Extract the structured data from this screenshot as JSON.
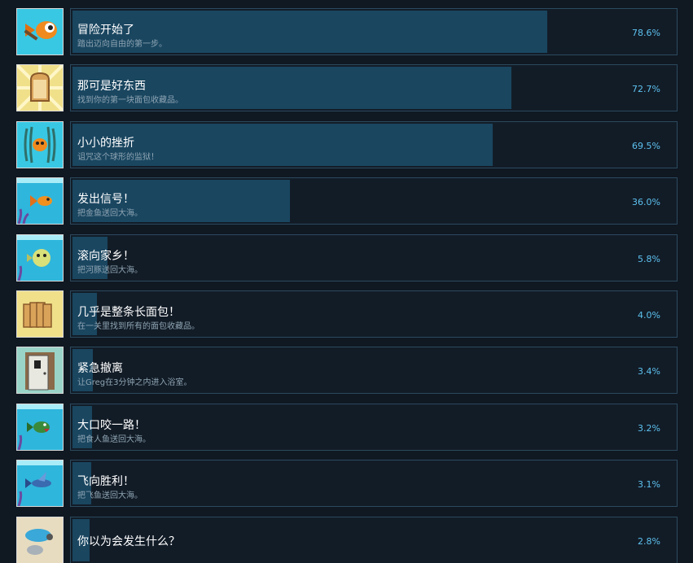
{
  "achievements": [
    {
      "title": "冒险开始了",
      "description": "踏出迈向自由的第一步。",
      "percent_label": "78.6%",
      "percent": 78.6,
      "icon": "fish-with-pipe-icon"
    },
    {
      "title": "那可是好东西",
      "description": "找到你的第一块面包收藏品。",
      "percent_label": "72.7%",
      "percent": 72.7,
      "icon": "bread-slice-icon"
    },
    {
      "title": "小小的挫折",
      "description": "诅咒这个球形的监狱！",
      "percent_label": "69.5%",
      "percent": 69.5,
      "icon": "fish-in-bowl-icon"
    },
    {
      "title": "发出信号！",
      "description": "把金鱼送回大海。",
      "percent_label": "36.0%",
      "percent": 36.0,
      "icon": "goldfish-sea-icon"
    },
    {
      "title": "滚向家乡！",
      "description": "把河豚送回大海。",
      "percent_label": "5.8%",
      "percent": 5.8,
      "icon": "pufferfish-icon"
    },
    {
      "title": "几乎是整条长面包！",
      "description": "在一关里找到所有的面包收藏品。",
      "percent_label": "4.0%",
      "percent": 4.0,
      "icon": "bread-loaf-icon"
    },
    {
      "title": "紧急撤离",
      "description": "让Greg在3分钟之内进入浴室。",
      "percent_label": "3.4%",
      "percent": 3.4,
      "icon": "door-icon"
    },
    {
      "title": "大口咬一路！",
      "description": "把食人鱼送回大海。",
      "percent_label": "3.2%",
      "percent": 3.2,
      "icon": "piranha-icon"
    },
    {
      "title": "飞向胜利！",
      "description": "把飞鱼送回大海。",
      "percent_label": "3.1%",
      "percent": 3.1,
      "icon": "flying-fish-icon"
    },
    {
      "title": "你以为会发生什么？",
      "description": "",
      "percent_label": "2.8%",
      "percent": 2.8,
      "icon": "broken-bowl-icon"
    }
  ],
  "colors": {
    "background": "#101822",
    "bar_fill": "#1a4660",
    "panel_border": "#2b4a5e",
    "title": "#ffffff",
    "description": "#8fa5b3",
    "percent": "#5dc2f0"
  }
}
